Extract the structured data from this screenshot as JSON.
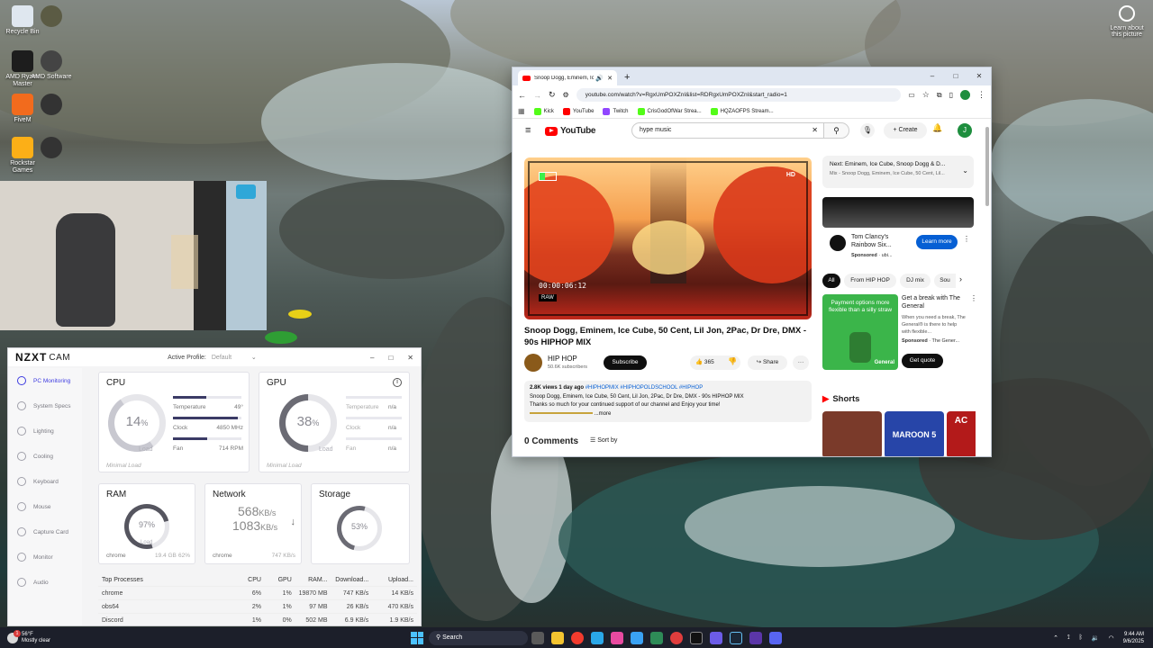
{
  "desktop": {
    "icons": [
      {
        "label": "Recycle Bin"
      },
      {
        "label": ""
      },
      {
        "label": "AMD Ryzen Master"
      },
      {
        "label": "AMD Software"
      },
      {
        "label": "FiveM"
      },
      {
        "label": ""
      },
      {
        "label": "Rockstar Games"
      },
      {
        "label": ""
      }
    ],
    "learn_label": "Learn about this picture"
  },
  "nzxt": {
    "logo": "NZXT",
    "cam": "CAM",
    "active_profile_label": "Active Profile:",
    "active_profile_value": "Default",
    "sidebar": [
      {
        "label": "PC Monitoring"
      },
      {
        "label": "System Specs"
      },
      {
        "label": "Lighting"
      },
      {
        "label": "Cooling"
      },
      {
        "label": "Keyboard"
      },
      {
        "label": "Mouse"
      },
      {
        "label": "Capture Card"
      },
      {
        "label": "Monitor"
      },
      {
        "label": "Audio"
      }
    ],
    "cpu": {
      "title": "CPU",
      "load": "14",
      "load_unit": "%",
      "load_label": "Load",
      "temp_label": "Temperature",
      "temp_value": "49°",
      "clock_label": "Clock",
      "clock_value": "4850 MHz",
      "fan_label": "Fan",
      "fan_value": "714 RPM",
      "status": "Minimal Load",
      "temp_fraction": 0.49,
      "clock_fraction": 0.95,
      "fan_fraction": 0.5
    },
    "gpu": {
      "title": "GPU",
      "load": "38",
      "load_unit": "%",
      "load_label": "Load",
      "temp_label": "Temperature",
      "temp_value": "n/a",
      "clock_label": "Clock",
      "clock_value": "n/a",
      "fan_label": "Fan",
      "fan_value": "n/a",
      "status": "Minimal Load"
    },
    "ram": {
      "title": "RAM",
      "load": "97%",
      "load_label": "Load",
      "proc": "chrome",
      "used": "19.4 GB",
      "pct": "62%"
    },
    "network": {
      "title": "Network",
      "down": "568",
      "down_unit": "KB/s",
      "up": "1083",
      "up_unit": "KB/s",
      "proc": "chrome",
      "proc_val": "747 KB/s"
    },
    "storage": {
      "title": "Storage",
      "load": "53%"
    },
    "table": {
      "headers": [
        "Top Processes",
        "CPU",
        "GPU",
        "RAM...",
        "Download...",
        "Upload..."
      ],
      "rows": [
        [
          "chrome",
          "6%",
          "1%",
          "19870 MB",
          "747 KB/s",
          "14 KB/s"
        ],
        [
          "obs64",
          "2%",
          "1%",
          "97 MB",
          "26 KB/s",
          "470 KB/s"
        ],
        [
          "Discord",
          "1%",
          "0%",
          "502 MB",
          "6.9 KB/s",
          "1.9 KB/s"
        ]
      ]
    }
  },
  "chrome": {
    "tab_title": "Snoop Dogg, Eminem, Ice C",
    "url": "youtube.com/watch?v=RgxUmPOXZnI&list=RDRgxUmPOXZnI&start_radio=1",
    "bookmarks": [
      {
        "label": "Kick",
        "color": "#53fc18"
      },
      {
        "label": "YouTube",
        "color": "#ff0000"
      },
      {
        "label": "Twitch",
        "color": "#9146ff"
      },
      {
        "label": "CrisGodOfWar Strea...",
        "color": "#53fc18"
      },
      {
        "label": "HQZAOFPS Stream...",
        "color": "#53fc18"
      }
    ]
  },
  "youtube": {
    "logo": "YouTube",
    "search_value": "hype music",
    "create_label": "Create",
    "avatar_letter": "J",
    "overlay_time": "00:00:06:12",
    "overlay_raw": "RAW",
    "overlay_hd": "HD",
    "video_title": "Snoop Dogg, Eminem, Ice Cube, 50 Cent, Lil Jon, 2Pac, Dr Dre, DMX - 90s HIPHOP MIX",
    "channel_name": "HIP HOP",
    "subscribers": "50.6K subscribers",
    "subscribe_label": "Subscribe",
    "likes": "365",
    "share_label": "Share",
    "views": "2.8K views",
    "date": "1 day ago",
    "hashtags": "#HIPHOPMIX #HIPHOPOLDSCHOOL #HIPHOP",
    "desc_line1": "Snoop Dogg, Eminem, Ice Cube, 50 Cent, Lil Jon, 2Pac, Dr Dre, DMX - 90s HIPHOP MIX",
    "desc_line2": "Thanks so much for your continued support of our channel and Enjoy your time!",
    "desc_more": "...more",
    "comments_label": "0 Comments",
    "sort_label": "Sort by",
    "next_label": "Next: Eminem, Ice Cube, Snoop Dogg & D...",
    "next_sub": "Mix - Snoop Dogg, Eminem, Ice Cube, 50 Cent, Lil...",
    "ad1_title": "Tom Clancy's Rainbow Six...",
    "ad1_sponsored": "Sponsored",
    "ad1_source": "· ubi...",
    "ad1_button": "Learn more",
    "chips": [
      "All",
      "From HIP HOP",
      "DJ mix",
      "Sou"
    ],
    "ad2_graphic_text": "Payment options more flexible than a silly straw",
    "ad2_title": "Get a break with The General",
    "ad2_desc": "When you need a break, The General® is there to help with flexible...",
    "ad2_sponsored": "Sponsored",
    "ad2_source": "· The Gener...",
    "ad2_button": "Get quote",
    "ad2_brand": "General",
    "shorts_label": "Shorts",
    "short2_text": "MAROON 5",
    "short3_text": "AC"
  },
  "taskbar": {
    "weather_temp": "56°F",
    "weather_desc": "Mostly clear",
    "search_label": "Search",
    "time": "9:44 AM",
    "date": "9/6/2025",
    "badge": "1"
  }
}
